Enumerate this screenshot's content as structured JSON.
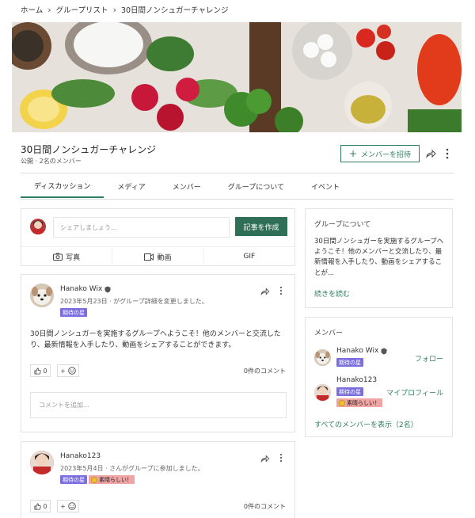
{
  "breadcrumb": [
    "ホーム",
    "グループリスト",
    "30日間ノンシュガーチャレンジ"
  ],
  "group": {
    "title": "30日間ノンシュガーチャレンジ",
    "meta": "公開 · 2名のメンバー",
    "invite_label": "メンバーを招待"
  },
  "tabs": [
    "ディスカッション",
    "メディア",
    "メンバー",
    "グループについて",
    "イベント"
  ],
  "composer": {
    "placeholder": "シェアしましょう...",
    "create_label": "記事を作成",
    "photo_label": "写真",
    "video_label": "動画",
    "gif_label": "GIF"
  },
  "posts": [
    {
      "author": "Hanako Wix",
      "date": "2023年5月23日 · がグループ詳細を変更しました。",
      "badge": "期待の星",
      "body": "30日間ノンシュガーを実施するグループへようこそ！他のメンバーと交流したり、最新情報を入手したり、動画をシェアすることができます。",
      "likes": "0",
      "comments": "0件のコメント",
      "comment_placeholder": "コメントを追加..."
    },
    {
      "author": "Hanako123",
      "date": "2023年5月4日 · さんがグループに参加しました。",
      "badge": "期待の星",
      "badge2": "素晴らしい！",
      "likes": "0",
      "comments": "0件のコメント"
    }
  ],
  "about": {
    "title": "グループについて",
    "text": "30日間ノンシュガーを実施するグループへようこそ！他のメンバーと交流したり、最新情報を入手したり、動画をシェアすることが...",
    "read_more": "続きを読む"
  },
  "members": {
    "title": "メンバー",
    "list": [
      {
        "name": "Hanako Wix",
        "badge": "期待の星",
        "action": "フォロー"
      },
      {
        "name": "Hanako123",
        "badge": "期待の星",
        "badge2": "素晴らしい！",
        "action": "マイプロフィール"
      }
    ],
    "show_all": "すべてのメンバーを表示（2名）"
  },
  "colors": {
    "accent": "#2f7d60",
    "button": "#2f6f58",
    "badge": "#7b6fe0",
    "badge_pink": "#f0a4a4"
  }
}
